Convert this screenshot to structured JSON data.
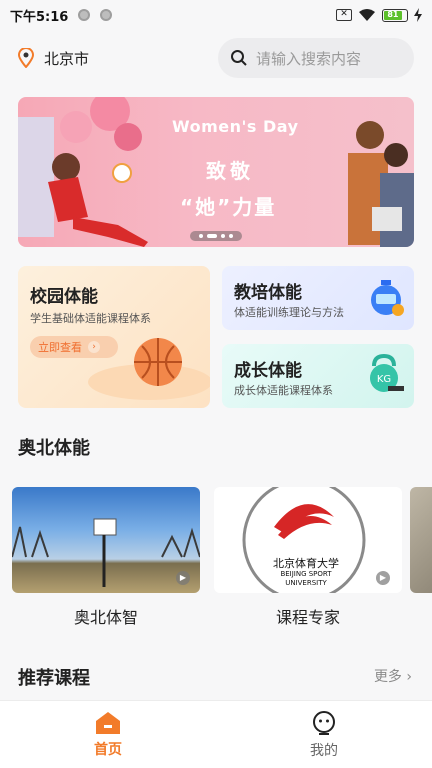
{
  "status_bar": {
    "time": "下午5:16",
    "battery_level": "81"
  },
  "header": {
    "location": "北京市",
    "search_placeholder": "请输入搜索内容"
  },
  "banner": {
    "headline_en": "Women's Day",
    "headline_cn_1": "致敬",
    "headline_cn_2": "“她”力量",
    "current_page": 2,
    "page_count": 4
  },
  "feature_cards": [
    {
      "title": "校园体能",
      "subtitle": "学生基础体适能课程体系",
      "action_label": "立即查看"
    },
    {
      "title": "教培体能",
      "subtitle": "体适能训练理论与方法"
    },
    {
      "title": "成长体能",
      "subtitle": "成长体适能课程体系"
    }
  ],
  "section_aobei": {
    "title": "奥北体能"
  },
  "videos": [
    {
      "caption": "奥北体智"
    },
    {
      "caption": "课程专家",
      "logo_text_cn": "北京体育大学",
      "logo_text_en_1": "BEIJING SPORT",
      "logo_text_en_2": "UNIVERSITY"
    }
  ],
  "section_recommend": {
    "title": "推荐课程",
    "more_label": "更多"
  },
  "tabbar": {
    "items": [
      {
        "label": "首页",
        "active": true
      },
      {
        "label": "我的",
        "active": false
      }
    ]
  },
  "colors": {
    "accent": "#f27b2a",
    "background": "#f7f7f8"
  }
}
